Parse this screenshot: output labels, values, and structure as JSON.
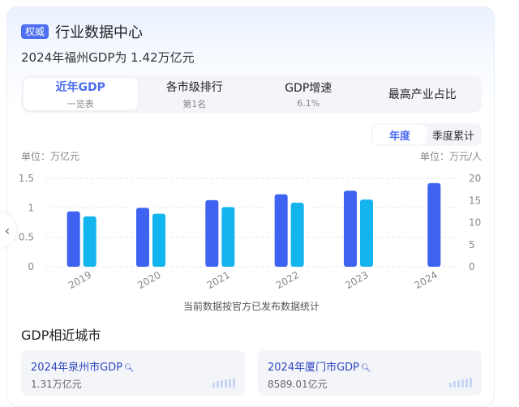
{
  "header": {
    "badge": "权威",
    "title": "行业数据中心"
  },
  "subtitle": {
    "prefix": "2024年福州GDP为 ",
    "value": "1.42万亿元"
  },
  "tabs": [
    {
      "label": "近年GDP",
      "sub": "一览表",
      "active": true
    },
    {
      "label": "各市级排行",
      "sub": "第1名",
      "active": false
    },
    {
      "label": "GDP增速",
      "sub": "6.1%",
      "active": false
    },
    {
      "label": "最高产业占比",
      "sub": "",
      "active": false
    }
  ],
  "segment": {
    "options": [
      "年度",
      "季度累计"
    ],
    "selected": "年度"
  },
  "units": {
    "left": "单位：万亿元",
    "right": "单位：万元/人"
  },
  "chart_data": {
    "type": "bar",
    "categories": [
      "2019",
      "2020",
      "2021",
      "2022",
      "2023",
      "2024"
    ],
    "series": [
      {
        "axis": "left",
        "color": "#3d63f0",
        "values": [
          0.94,
          1.0,
          1.13,
          1.23,
          1.29,
          1.42
        ]
      },
      {
        "axis": "right",
        "color": "#14b4ef",
        "values": [
          11.4,
          12.0,
          13.5,
          14.5,
          15.2,
          null
        ]
      }
    ],
    "y_left": {
      "ticks": [
        "0",
        "0.5",
        "1",
        "1.5"
      ],
      "ylim": [
        0,
        1.5
      ]
    },
    "y_right": {
      "ticks": [
        "0",
        "5",
        "10",
        "15",
        "20"
      ],
      "ylim": [
        0,
        20
      ]
    },
    "grid": true
  },
  "note": "当前数据按官方已发布数据统计",
  "similar": {
    "title": "GDP相近城市",
    "cards": [
      {
        "name": "2024年泉州市GDP",
        "value": "1.31万亿元"
      },
      {
        "name": "2024年厦门市GDP",
        "value": "8589.01亿元"
      }
    ]
  },
  "icons": {
    "side": "chevron-left-icon",
    "search": "search-icon"
  }
}
